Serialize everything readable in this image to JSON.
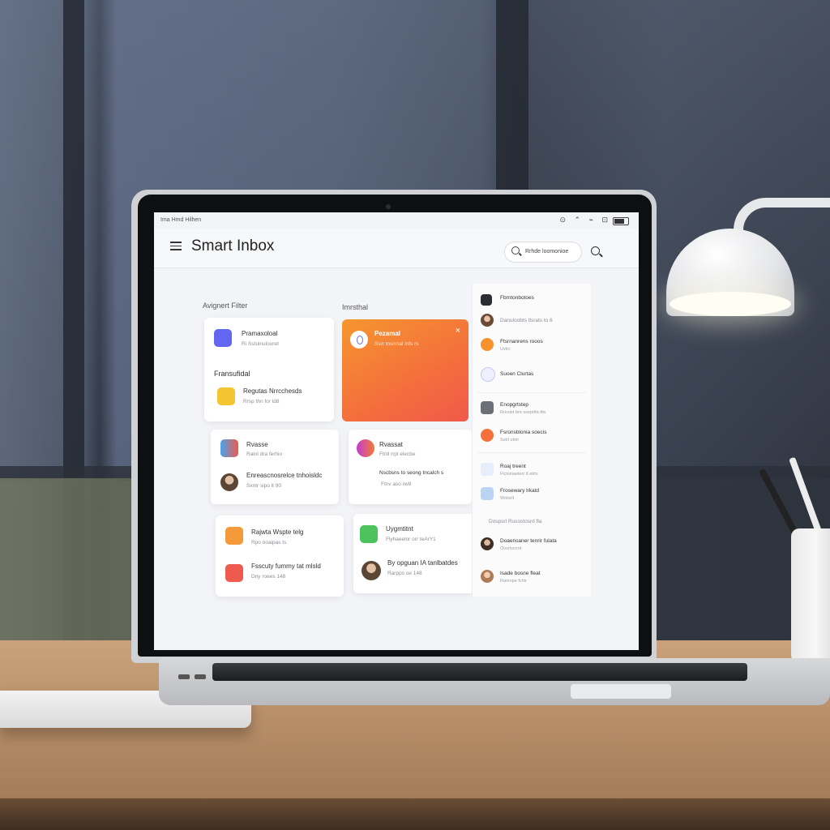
{
  "status_bar": {
    "time_text": "Ima Hmd Hilhen"
  },
  "app": {
    "title": "Smart Inbox",
    "search_placeholder": "Rrhde loomonioe"
  },
  "sections": {
    "left_label": "Avignert Filter",
    "middle_label": "Imrsthal"
  },
  "cards": [
    {
      "title": "Pramaxoloal",
      "subtitle": "Ri Sstulnulouret"
    },
    {
      "title": "Fransufidal",
      "subtitle": ""
    },
    {
      "title": "Regutas Nrrcchesds",
      "subtitle": "Rrsp thn for ld8"
    },
    {
      "title": "Rvasse",
      "subtitle": "Rainl dra ferhio"
    },
    {
      "title": "Enreascnosrelce tnhoisldc",
      "subtitle": "Sxntr sipo lt 90"
    },
    {
      "title": "Rvassat",
      "subtitle": "Ftnll rrpl elecbe"
    },
    {
      "title": "Nscbsns to seong tncalch s",
      "subtitle": "Ftnv aso rw8"
    },
    {
      "title": "Rajwta Wspte telg",
      "subtitle": "Rpo noaipas ts"
    },
    {
      "title": "Fsscuty fummy tat mlsld",
      "subtitle": "Dny roees 148"
    },
    {
      "title": "Uygmtitnt",
      "subtitle": "Flyhaeelor orr teArY1"
    },
    {
      "title": "By opguan IA tanlbatdes",
      "subtitle": "Rarpps oe 148"
    }
  ],
  "hero_card": {
    "title": "Pezamal",
    "subtitle": "Ssrr tnsrrnal lnfs rs",
    "close": "×"
  },
  "side_items": [
    {
      "title": "Fbrntonbotoes",
      "subtitle": ""
    },
    {
      "title": "Danuloobts tlsrats to 6",
      "subtitle": ""
    },
    {
      "title": "Ftsrnanrens rooos",
      "subtitle": "Uvtrc"
    },
    {
      "title": "Suoen Clurtas",
      "subtitle": ""
    },
    {
      "title": "Enopgrtstep",
      "subtitle": "Rreslet bre ssepttfa tfw"
    },
    {
      "title": "Fsronsblonia soecis",
      "subtitle": "Sxtrl ofolr"
    },
    {
      "title": "Roaj treent",
      "subtitle": "Flctsinaeterr 8 ekts"
    },
    {
      "title": "Frosewary lrkatd",
      "subtitle": "Wnhelt"
    },
    {
      "title": "Dospsrl Rusostosrd fla",
      "subtitle": ""
    },
    {
      "title": "Doaensaner tenrir fulata",
      "subtitle": "Ovorlsccrd"
    },
    {
      "title": "Isade bosne fleat",
      "subtitle": "Ramnpe fchtr"
    }
  ],
  "colors": {
    "accent_purple": "#6366f1",
    "accent_orange": "#f4713b",
    "accent_yellow": "#f5c431",
    "accent_green": "#4cc35c",
    "accent_red": "#ef5a4e"
  }
}
